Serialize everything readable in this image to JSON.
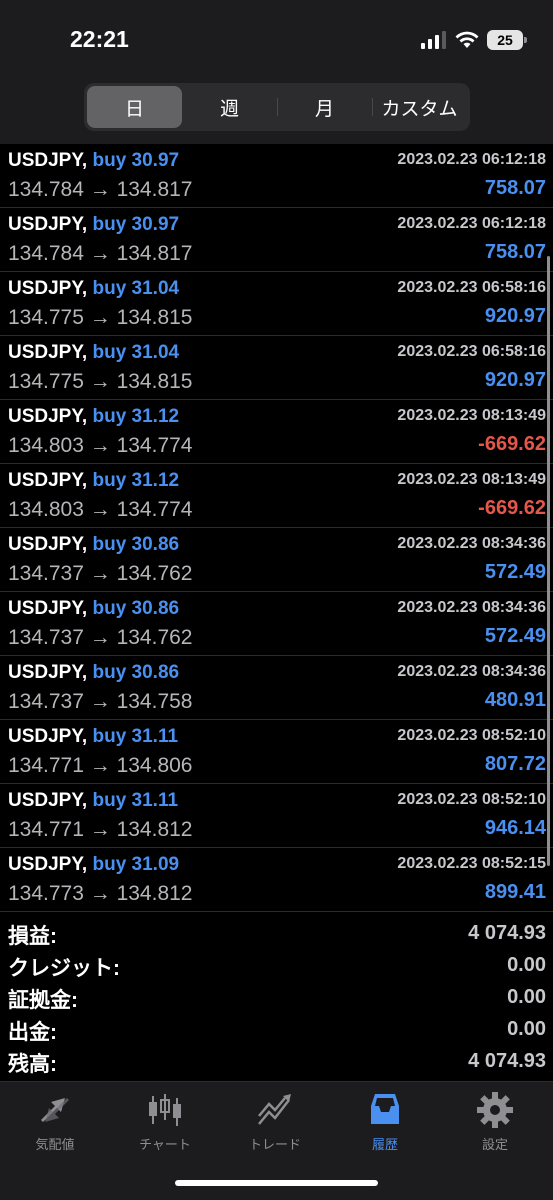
{
  "status": {
    "time": "22:21",
    "battery": "25"
  },
  "segments": [
    {
      "label": "日",
      "active": true
    },
    {
      "label": "週",
      "active": false
    },
    {
      "label": "月",
      "active": false
    },
    {
      "label": "カスタム",
      "active": false
    }
  ],
  "trades": [
    {
      "symbol": "USDJPY,",
      "side": "buy 30.97",
      "time": "2023.02.23 06:12:18",
      "prices": "134.784 → 134.817",
      "profit": "758.07",
      "negative": false
    },
    {
      "symbol": "USDJPY,",
      "side": "buy 30.97",
      "time": "2023.02.23 06:12:18",
      "prices": "134.784 → 134.817",
      "profit": "758.07",
      "negative": false
    },
    {
      "symbol": "USDJPY,",
      "side": "buy 31.04",
      "time": "2023.02.23 06:58:16",
      "prices": "134.775 → 134.815",
      "profit": "920.97",
      "negative": false
    },
    {
      "symbol": "USDJPY,",
      "side": "buy 31.04",
      "time": "2023.02.23 06:58:16",
      "prices": "134.775 → 134.815",
      "profit": "920.97",
      "negative": false
    },
    {
      "symbol": "USDJPY,",
      "side": "buy 31.12",
      "time": "2023.02.23 08:13:49",
      "prices": "134.803 → 134.774",
      "profit": "-669.62",
      "negative": true
    },
    {
      "symbol": "USDJPY,",
      "side": "buy 31.12",
      "time": "2023.02.23 08:13:49",
      "prices": "134.803 → 134.774",
      "profit": "-669.62",
      "negative": true
    },
    {
      "symbol": "USDJPY,",
      "side": "buy 30.86",
      "time": "2023.02.23 08:34:36",
      "prices": "134.737 → 134.762",
      "profit": "572.49",
      "negative": false
    },
    {
      "symbol": "USDJPY,",
      "side": "buy 30.86",
      "time": "2023.02.23 08:34:36",
      "prices": "134.737 → 134.762",
      "profit": "572.49",
      "negative": false
    },
    {
      "symbol": "USDJPY,",
      "side": "buy 30.86",
      "time": "2023.02.23 08:34:36",
      "prices": "134.737 → 134.758",
      "profit": "480.91",
      "negative": false
    },
    {
      "symbol": "USDJPY,",
      "side": "buy 31.11",
      "time": "2023.02.23 08:52:10",
      "prices": "134.771 → 134.806",
      "profit": "807.72",
      "negative": false
    },
    {
      "symbol": "USDJPY,",
      "side": "buy 31.11",
      "time": "2023.02.23 08:52:10",
      "prices": "134.771 → 134.812",
      "profit": "946.14",
      "negative": false
    },
    {
      "symbol": "USDJPY,",
      "side": "buy 31.09",
      "time": "2023.02.23 08:52:15",
      "prices": "134.773 → 134.812",
      "profit": "899.41",
      "negative": false
    }
  ],
  "summary": [
    {
      "label": "損益:",
      "value": "4 074.93"
    },
    {
      "label": "クレジット:",
      "value": "0.00"
    },
    {
      "label": "証拠金:",
      "value": "0.00"
    },
    {
      "label": "出金:",
      "value": "0.00"
    },
    {
      "label": "残高:",
      "value": "4 074.93"
    }
  ],
  "tabs": [
    {
      "label": "気配値",
      "icon": "quotes-icon",
      "active": false
    },
    {
      "label": "チャート",
      "icon": "chart-icon",
      "active": false
    },
    {
      "label": "トレード",
      "icon": "trade-icon",
      "active": false
    },
    {
      "label": "履歴",
      "icon": "history-icon",
      "active": true
    },
    {
      "label": "設定",
      "icon": "settings-icon",
      "active": false
    }
  ],
  "colors": {
    "accent": "#4a90f0",
    "negative": "#e5574a",
    "background": "#000000",
    "bar": "#1c1c1e"
  }
}
